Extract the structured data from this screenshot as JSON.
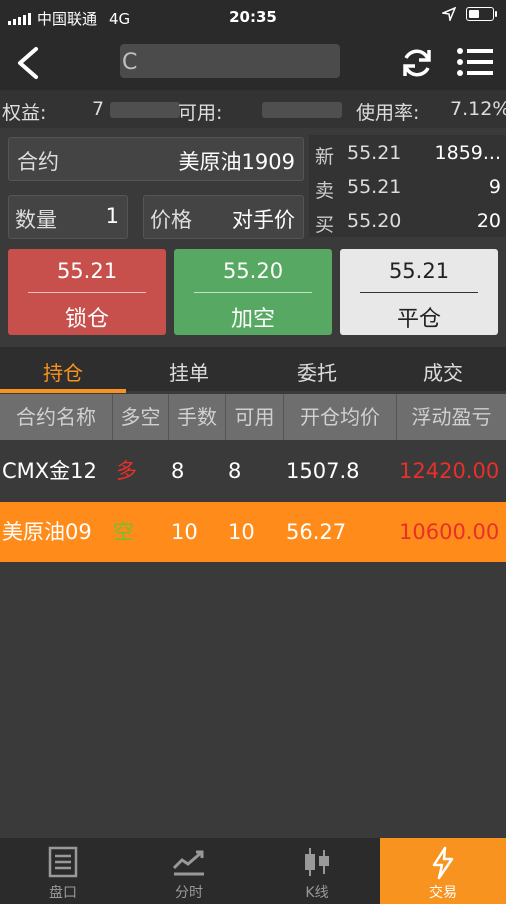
{
  "status_bar": {
    "carrier": "中国联通",
    "network": "4G",
    "time": "20:35"
  },
  "nav": {
    "title_visible_char": "C"
  },
  "account": {
    "equity_label": "权益:",
    "equity_visible": "7",
    "available_label": "可用:",
    "usage_label": "使用率:",
    "usage_value": "7.12%"
  },
  "order_form": {
    "contract_label": "合约",
    "contract_value": "美原油1909",
    "quantity_label": "数量",
    "quantity_value": "1",
    "price_label": "价格",
    "price_value": "对手价"
  },
  "quote": [
    {
      "key": "新",
      "price": "55.21",
      "volume": "1859..."
    },
    {
      "key": "卖",
      "price": "55.21",
      "volume": "9"
    },
    {
      "key": "买",
      "price": "55.20",
      "volume": "20"
    }
  ],
  "buttons": [
    {
      "price": "55.21",
      "name": "锁仓",
      "color": "#c8504c"
    },
    {
      "price": "55.20",
      "name": "加空",
      "color": "#57a862"
    },
    {
      "price": "55.21",
      "name": "平仓",
      "color": "#e8e8e8"
    }
  ],
  "tabs": [
    "持仓",
    "挂单",
    "委托",
    "成交"
  ],
  "active_tab": "持仓",
  "table": {
    "headers": [
      "合约名称",
      "多空",
      "手数",
      "可用",
      "开仓均价",
      "浮动盈亏"
    ],
    "rows": [
      [
        "CMX金12",
        "多",
        "8",
        "8",
        "1507.8",
        "12420.00"
      ],
      [
        "美原油09",
        "空",
        "10",
        "10",
        "56.27",
        "10600.00"
      ]
    ]
  },
  "tabbar": [
    {
      "icon": "market-depth-icon",
      "label": "盘口"
    },
    {
      "icon": "timeshare-chart-icon",
      "label": "分时"
    },
    {
      "icon": "candlestick-icon",
      "label": "K线"
    },
    {
      "icon": "lightning-icon",
      "label": "交易"
    }
  ],
  "colors": {
    "accent": "#f7931e",
    "long": "#e8302a",
    "short": "#6fc22d",
    "profit": "#e8302a"
  }
}
